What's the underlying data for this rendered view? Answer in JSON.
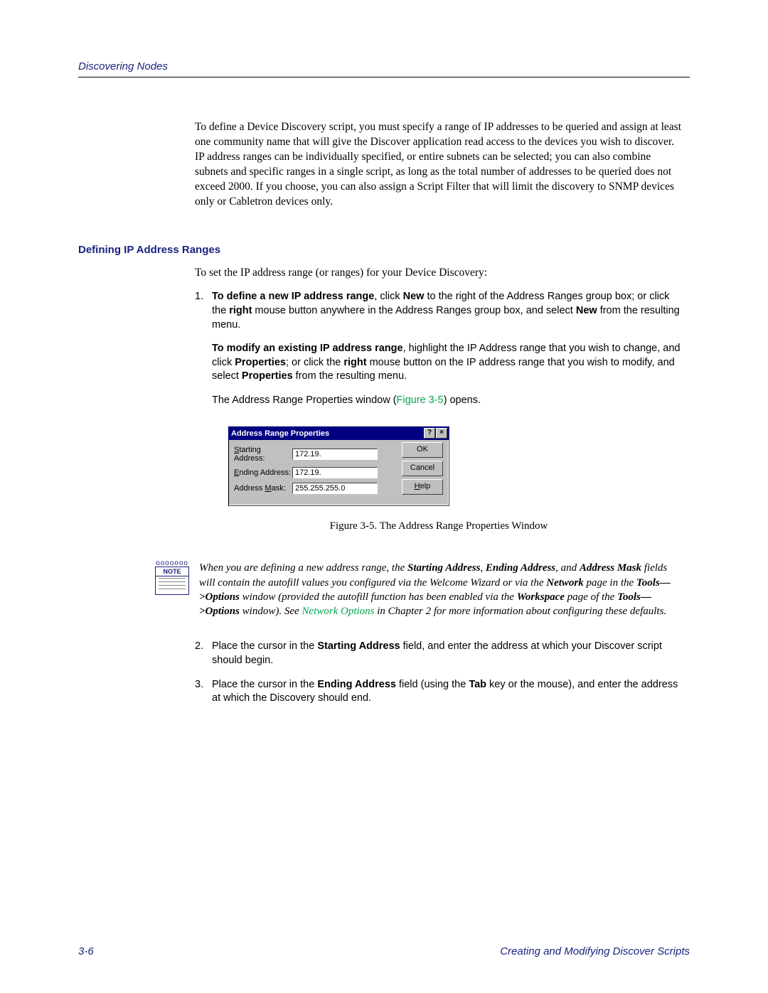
{
  "header": {
    "running_head": "Discovering Nodes"
  },
  "intro": "To define a Device Discovery script, you must specify a range of IP addresses to be queried and assign at least one community name that will give the Discover application read access to the devices you wish to discover. IP address ranges can be individually specified, or entire subnets can be selected; you can also combine subnets and specific ranges in a single script, as long as the total number of addresses to be queried does not exceed 2000. If you choose, you can also assign a Script Filter that will limit the discovery to SNMP devices only or Cabletron devices only.",
  "section_heading": "Defining IP Address Ranges",
  "lead": "To set the IP address range (or ranges) for your Device Discovery:",
  "step1": {
    "num": "1.",
    "a_b1": "To define a new IP address range",
    "a_t1": ", click ",
    "a_b2": "New",
    "a_t2": " to the right of the Address Ranges group box; or click the ",
    "a_b3": "right",
    "a_t3": " mouse button anywhere in the Address Ranges group box, and select ",
    "a_b4": "New",
    "a_t4": " from the resulting menu.",
    "b_b1": "To modify an existing IP address range",
    "b_t1": ", highlight the IP Address range that you wish to change, and click ",
    "b_b2": "Properties",
    "b_t2": "; or click the ",
    "b_b3": "right",
    "b_t3": " mouse button on the IP address range that you wish to modify, and select ",
    "b_b4": "Properties",
    "b_t4": " from the resulting menu.",
    "c_t1": "The Address Range Properties window (",
    "c_link": "Figure 3-5",
    "c_t2": ") opens."
  },
  "dialog": {
    "title": "Address Range Properties",
    "help_btn": "?",
    "close_btn": "×",
    "rows": [
      {
        "label_pre": "S",
        "label_mid": "tarting Address:",
        "value": "172.19."
      },
      {
        "label_pre": "E",
        "label_mid": "nding Address:",
        "value": "172.19."
      },
      {
        "label_pre": "Address ",
        "label_u": "M",
        "label_post": "ask:",
        "value": "255.255.255.0"
      }
    ],
    "buttons": {
      "ok": "OK",
      "cancel": "Cancel",
      "help_pre": "H",
      "help_post": "elp"
    }
  },
  "figure_caption": "Figure 3-5.  The Address Range Properties Window",
  "note": {
    "label": "NOTE",
    "t1": "When you are defining a new address range, the ",
    "b1": "Starting Address",
    "t2": ", ",
    "b2": "Ending Address",
    "t3": ", and ",
    "b3": "Address Mask",
    "t4": " fields will contain the autofill values you configured via the Welcome Wizard or via the ",
    "b4": "Network",
    "t5": " page in the ",
    "b5": "Tools—>Options",
    "t6": " window (provided the autofill function has been enabled via the ",
    "b6": "Workspace",
    "t7": " page of the ",
    "b7": "Tools—>Options",
    "t8": " window). See ",
    "link": "Network Options",
    "t9": " in Chapter 2 for more information about configuring these defaults."
  },
  "step2": {
    "num": "2.",
    "t1": "Place the cursor in the ",
    "b1": "Starting Address",
    "t2": " field, and enter the address at which your Discover script should begin."
  },
  "step3": {
    "num": "3.",
    "t1": "Place the cursor in the ",
    "b1": "Ending Address",
    "t2": " field (using the ",
    "b2": "Tab",
    "t3": " key or the mouse), and enter the address at which the Discovery should end."
  },
  "footer": {
    "page": "3-6",
    "section": "Creating and Modifying Discover Scripts"
  }
}
